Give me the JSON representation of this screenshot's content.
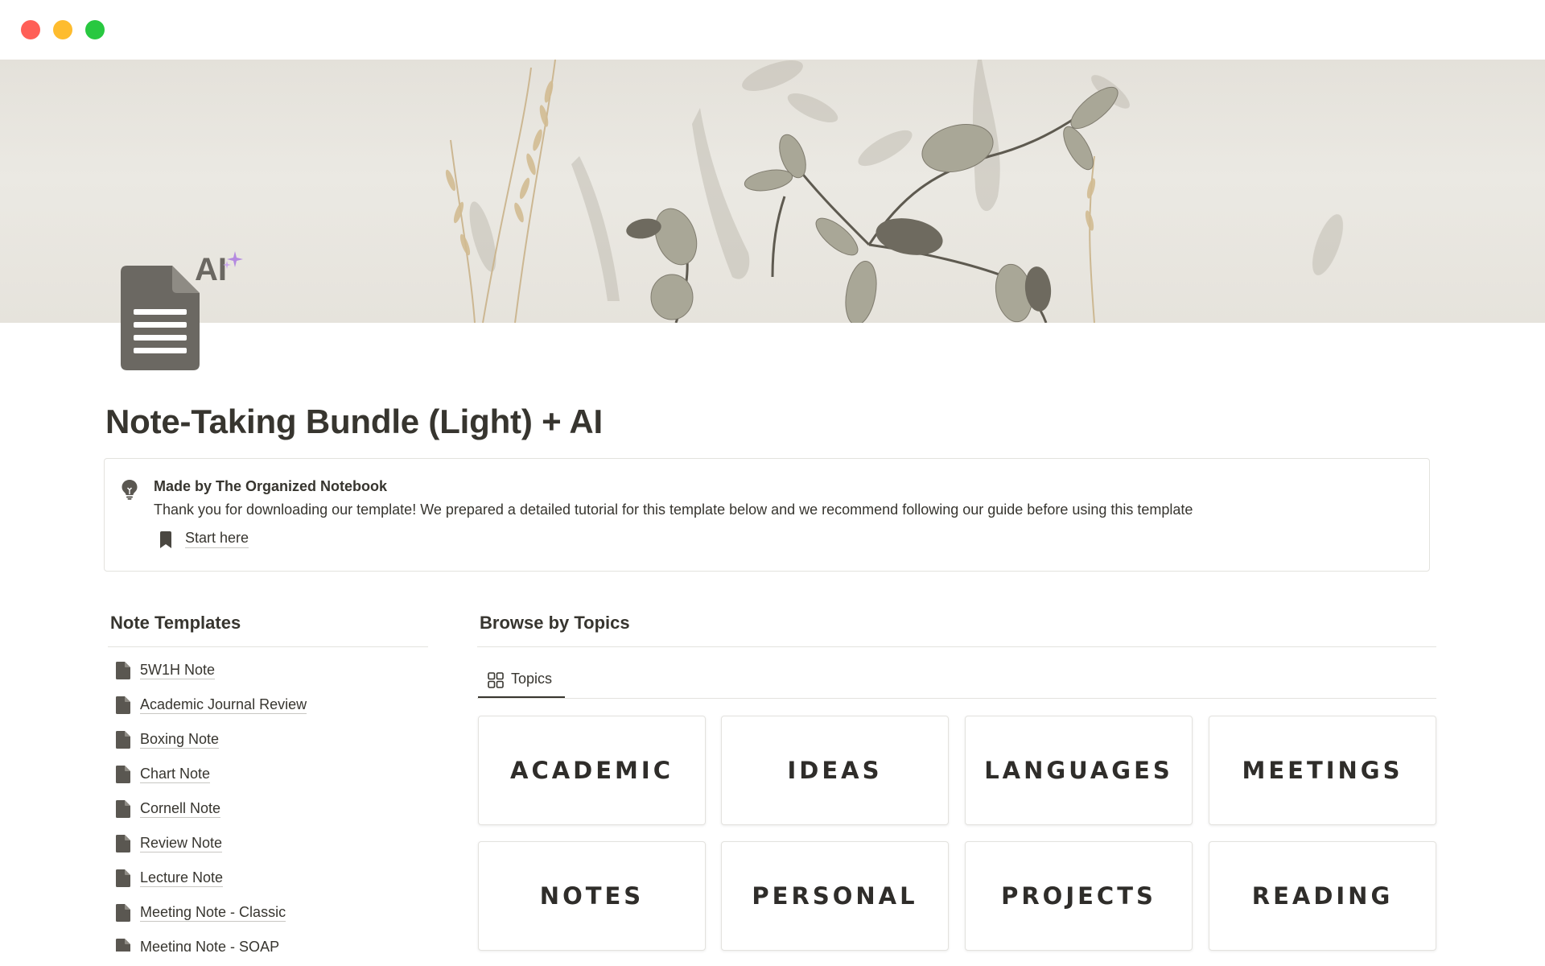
{
  "page": {
    "title": "Note-Taking Bundle (Light) + AI",
    "icon": "document-ai-icon",
    "icon_badge": "AI"
  },
  "window_controls": [
    "close",
    "minimize",
    "maximize"
  ],
  "callout": {
    "icon": "lightbulb-icon",
    "title": "Made by The Organized Notebook",
    "body": "Thank you for downloading our template! We prepared a detailed tutorial for this template below and we recommend following our guide before using this template",
    "link": {
      "icon": "bookmark-icon",
      "label": "Start here"
    }
  },
  "note_templates": {
    "heading": "Note Templates",
    "items": [
      {
        "icon": "document-icon",
        "label": "5W1H Note"
      },
      {
        "icon": "document-icon",
        "label": "Academic Journal Review"
      },
      {
        "icon": "document-icon",
        "label": "Boxing Note"
      },
      {
        "icon": "document-icon",
        "label": "Chart Note"
      },
      {
        "icon": "document-icon",
        "label": "Cornell Note"
      },
      {
        "icon": "document-icon",
        "label": "Review Note"
      },
      {
        "icon": "document-icon",
        "label": "Lecture Note"
      },
      {
        "icon": "document-icon",
        "label": "Meeting Note - Classic"
      },
      {
        "icon": "document-icon",
        "label": "Meeting Note - SOAP"
      }
    ]
  },
  "browse": {
    "heading": "Browse by Topics",
    "tab": {
      "icon": "gallery-grid-icon",
      "label": "Topics"
    },
    "topics": [
      "ACADEMIC",
      "IDEAS",
      "LANGUAGES",
      "MEETINGS",
      "NOTES",
      "PERSONAL",
      "PROJECTS",
      "READING"
    ]
  },
  "colors": {
    "text": "#37352f",
    "icon": "#6b6862",
    "border": "#e3e2de",
    "ai_sparkle": "#b48ae0"
  }
}
